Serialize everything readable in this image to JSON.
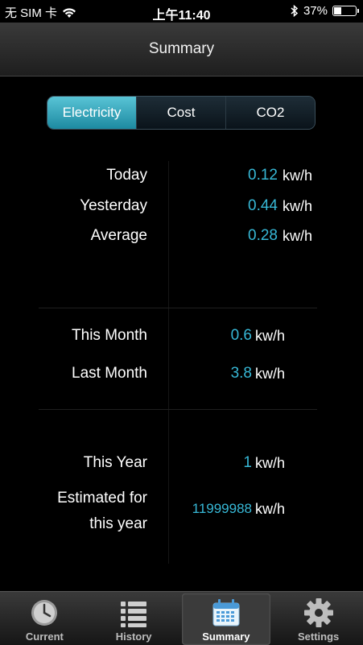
{
  "status_bar": {
    "carrier": "无 SIM 卡",
    "time": "上午11:40",
    "battery_percent": "37%",
    "battery_level": 0.37
  },
  "nav": {
    "title": "Summary"
  },
  "segments": [
    "Electricity",
    "Cost",
    "CO2"
  ],
  "selected_segment": "Electricity",
  "accent_color": "#37b8d6",
  "daily": [
    {
      "label": "Today",
      "value": "0.12",
      "unit": "kw/h"
    },
    {
      "label": "Yesterday",
      "value": "0.44",
      "unit": "kw/h"
    },
    {
      "label": "Average",
      "value": "0.28",
      "unit": "kw/h"
    }
  ],
  "monthly": [
    {
      "label": "This Month",
      "value": "0.6",
      "unit": "kw/h"
    },
    {
      "label": "Last Month",
      "value": "3.8",
      "unit": "kw/h"
    }
  ],
  "yearly": [
    {
      "label": "This Year",
      "value": "1",
      "unit": "kw/h"
    },
    {
      "label_line1": "Estimated for",
      "label_line2": "this year",
      "value": "11999988",
      "unit": "kw/h"
    }
  ],
  "tabs": [
    {
      "label": "Current",
      "icon": "clock-icon"
    },
    {
      "label": "History",
      "icon": "list-icon"
    },
    {
      "label": "Summary",
      "icon": "calendar-icon"
    },
    {
      "label": "Settings",
      "icon": "gear-icon"
    }
  ],
  "active_tab": "Summary"
}
